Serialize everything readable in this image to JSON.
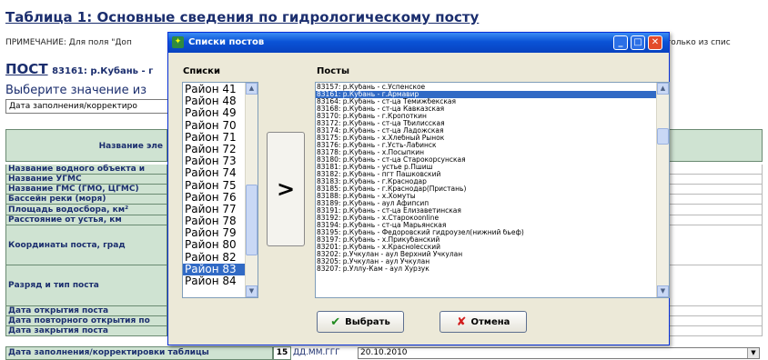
{
  "form": {
    "title": "Таблица 1: Основные сведения по гидрологическому посту",
    "note_left": "ПРИМЕЧАНИЕ: Для поля \"Доп",
    "note_right": "только из спис",
    "post_label": "ПОСТ",
    "post_value": "83161: р.Кубань - г",
    "choose_label": "Выберите значение из",
    "combo_value": "Дата заполнения/корректиро",
    "header_label": "Название эле",
    "rows": [
      "Название водного объекта и",
      "Название УГМС",
      "Название ГМС (ГМО, ЦГМС)",
      "Бассейн реки (моря)",
      "Площадь водосбора, км²",
      "Расстояние от устья, км",
      "Координаты поста, град",
      "Разряд и тип поста",
      "Дата открытия поста",
      "Дата повторного открытия по",
      "Дата закрытия поста"
    ],
    "last_row": {
      "label": "Дата заполнения/корректировки таблицы",
      "number": "15",
      "format": "ДД.ММ.ГГГ",
      "value": "20.10.2010"
    }
  },
  "dialog": {
    "title": "Списки постов",
    "lists_label": "Списки",
    "posts_label": "Посты",
    "move_button": ">",
    "ok_button": "Выбрать",
    "cancel_button": "Отмена",
    "districts": [
      "Район 41",
      "Район 48",
      "Район 49",
      "Район 70",
      "Район 71",
      "Район 72",
      "Район 73",
      "Район 74",
      "Район 75",
      "Район 76",
      "Район 77",
      "Район 78",
      "Район 79",
      "Район 80",
      "Район 82",
      "Район 83",
      "Район 84"
    ],
    "selected_district": "Район 83",
    "posts": [
      "83157: р.Кубань - с.Успенское",
      "83161: р.Кубань - г.Армавир",
      "83164: р.Кубань - ст-ца Темижбекская",
      "83168: р.Кубань - ст-ца Кавказская",
      "83170: р.Кубань - г.Кропоткин",
      "83172: р.Кубань - ст-ца Тбилисская",
      "83174: р.Кубань - ст-ца Ладожская",
      "83175: р.Кубань - х.Хлебный Рынок",
      "83176: р.Кубань - г.Усть-Лабинск",
      "83178: р.Кубань - х.Посыпкин",
      "83180: р.Кубань - ст-ца Старокорсунская",
      "83181: р.Кубань - устье р.Пшиш",
      "83182: р.Кубань - пгт Пашковский",
      "83183: р.Кубань - г.Краснодар",
      "83185: р.Кубань - г.Краснодар(Пристань)",
      "83188: р.Кубань - х.Хомуты",
      "83189: р.Кубань - аул Афипсип",
      "83191: р.Кубань - ст-ца Елизаветинская",
      "83192: р.Кубань - х.Старокоonline",
      "83194: р.Кубань - ст-ца Марьянская",
      "83195: р.Кубань - Федоровский гидроузел(нижний бьеф)",
      "83197: р.Кубань - х.Прикубанский",
      "83201: р.Кубань - х.Красноlесский",
      "83202: р.Учкулан - аул Верхний Учкулан",
      "83205: р.Учкулан - аул Учкулан",
      "83207: р.Уллу-Кам - аул Хурзук"
    ],
    "selected_post": "83161: р.Кубань - г.Армавир"
  }
}
